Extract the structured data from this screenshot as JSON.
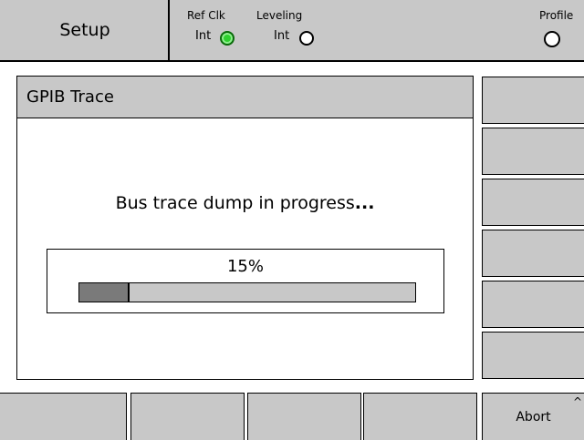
{
  "header": {
    "setup_label": "Setup",
    "ref_clk": {
      "title": "Ref Clk",
      "value": "Int",
      "indicator": "on",
      "color": "#2fd02f"
    },
    "leveling": {
      "title": "Leveling",
      "value": "Int",
      "indicator": "off"
    },
    "profile": {
      "title": "Profile",
      "indicator": "off"
    }
  },
  "panel": {
    "title": "GPIB Trace",
    "message_main": "Bus trace dump in progress",
    "message_ellipsis": "...",
    "progress": {
      "label": "15%",
      "fraction": 0.15
    }
  },
  "right_softkeys": [
    "",
    "",
    "",
    "",
    "",
    ""
  ],
  "bottom_softkeys": [
    "",
    "",
    "",
    "",
    "Abort"
  ],
  "abort_caret": "^"
}
